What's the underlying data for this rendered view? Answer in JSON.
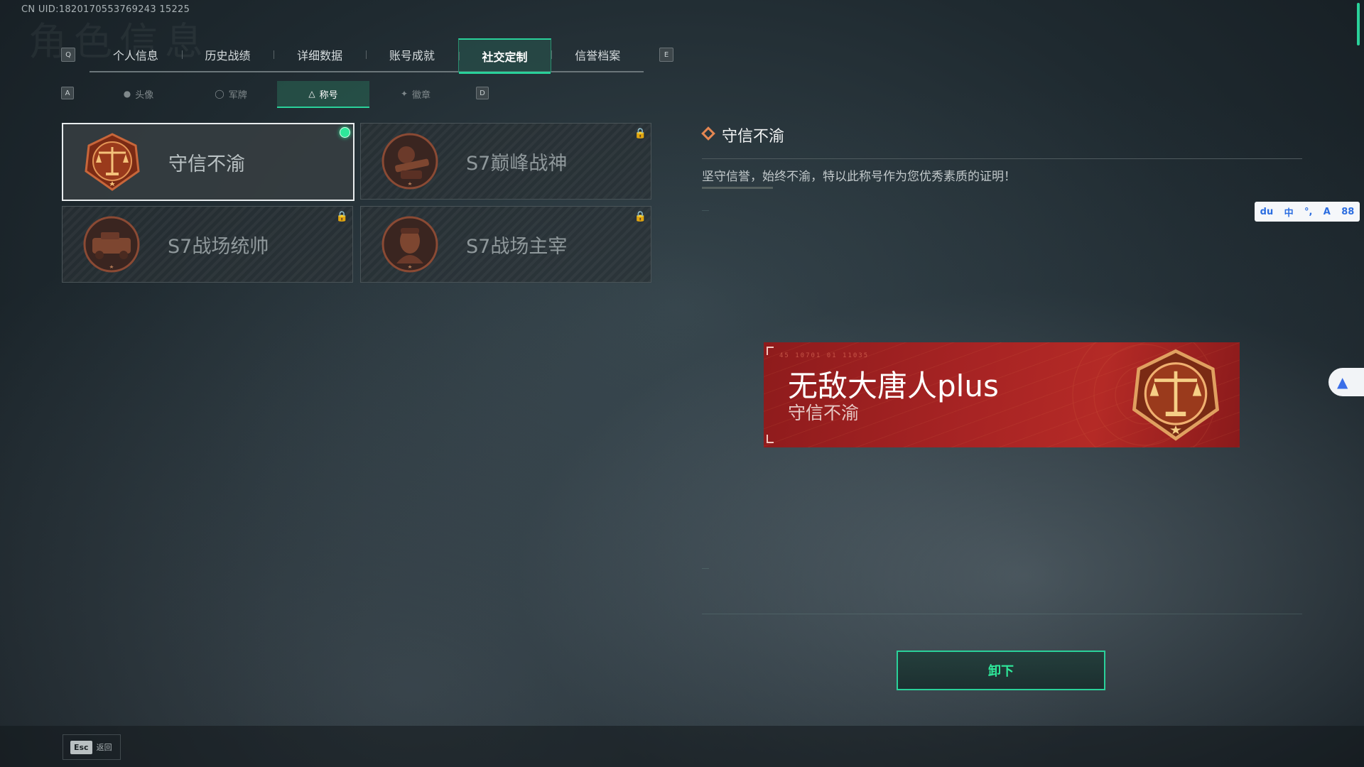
{
  "uid": "CN UID:1820170553769243 15225",
  "main_tabs": [
    "个人信息",
    "历史战绩",
    "详细数据",
    "账号成就",
    "社交定制",
    "信誉档案"
  ],
  "main_tab_keys": {
    "left": "Q",
    "right": "E"
  },
  "sub_tabs": [
    {
      "label": "头像",
      "icon": "person-icon"
    },
    {
      "label": "军牌",
      "icon": "dogtag-icon"
    },
    {
      "label": "称号",
      "icon": "title-icon"
    },
    {
      "label": "徽章",
      "icon": "badge-icon"
    }
  ],
  "sub_tab_keys": {
    "left": "A",
    "right": "D"
  },
  "titles": [
    {
      "label": "守信不渝",
      "emblem": "scales-emblem",
      "equipped": true,
      "locked": false
    },
    {
      "label": "S7巅峰战神",
      "emblem": "gunner-emblem",
      "equipped": false,
      "locked": true
    },
    {
      "label": "S7战场统帅",
      "emblem": "vehicle-emblem",
      "equipped": false,
      "locked": true
    },
    {
      "label": "S7战场主宰",
      "emblem": "commander-emblem",
      "equipped": false,
      "locked": true
    }
  ],
  "detail": {
    "title": "守信不渝",
    "description": "坚守信誉，始终不渝，特以此称号作为您优秀素质的证明！"
  },
  "banner": {
    "player_name": "无敌大唐人plus",
    "title": "守信不渝",
    "codes": "45 10701   01 11035"
  },
  "ime_toolbar": [
    "du",
    "中",
    "°,",
    "A",
    "88"
  ],
  "unequip_label": "卸下",
  "esc": {
    "key": "Esc",
    "label": "返回"
  },
  "colors": {
    "accent": "#2ad19a",
    "banner_red": "#a82424",
    "emblem_orange": "#d9772f"
  }
}
